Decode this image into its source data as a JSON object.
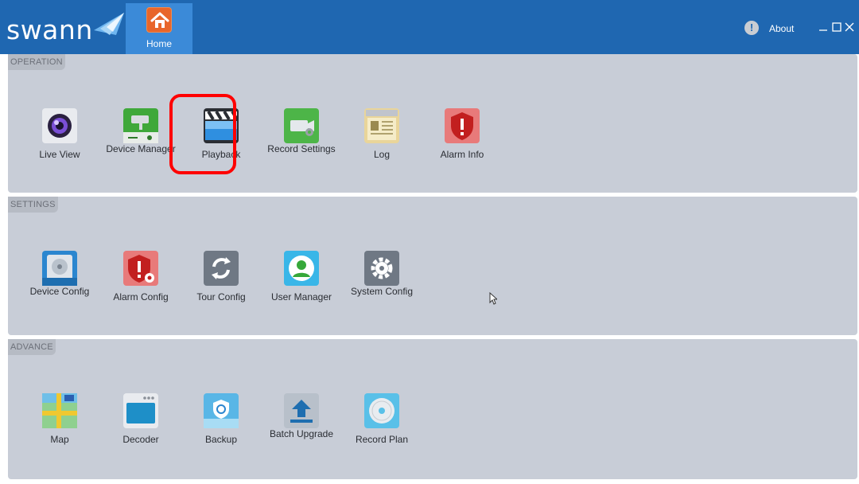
{
  "header": {
    "logo_text": "swann",
    "home_label": "Home",
    "about_label": "About",
    "about_icon": "!"
  },
  "sections": {
    "operation": {
      "title": "OPERATION",
      "items": [
        {
          "label": "Live View",
          "icon": "camera-lens-icon"
        },
        {
          "label": "Device Manager",
          "icon": "cctv-camera-icon"
        },
        {
          "label": "Playback",
          "icon": "clapperboard-icon"
        },
        {
          "label": "Record Settings",
          "icon": "video-camera-settings-icon"
        },
        {
          "label": "Log",
          "icon": "log-book-icon"
        },
        {
          "label": "Alarm Info",
          "icon": "alarm-shield-icon"
        }
      ]
    },
    "settings": {
      "title": "SETTINGS",
      "items": [
        {
          "label": "Device Config",
          "icon": "hard-drive-icon"
        },
        {
          "label": "Alarm Config",
          "icon": "alarm-config-icon"
        },
        {
          "label": "Tour Config",
          "icon": "refresh-arrows-icon"
        },
        {
          "label": "User Manager",
          "icon": "user-icon"
        },
        {
          "label": "System Config",
          "icon": "gear-icon"
        }
      ]
    },
    "advance": {
      "title": "ADVANCE",
      "items": [
        {
          "label": "Map",
          "icon": "map-icon"
        },
        {
          "label": "Decoder",
          "icon": "decoder-icon"
        },
        {
          "label": "Backup",
          "icon": "backup-icon"
        },
        {
          "label": "Batch Upgrade",
          "icon": "upload-icon"
        },
        {
          "label": "Record Plan",
          "icon": "disc-icon"
        }
      ]
    }
  },
  "colors": {
    "header": "#1f67b1",
    "home_tab": "#3b8ad8",
    "panel": "#c8cdd7",
    "highlight": "#ff0000"
  }
}
